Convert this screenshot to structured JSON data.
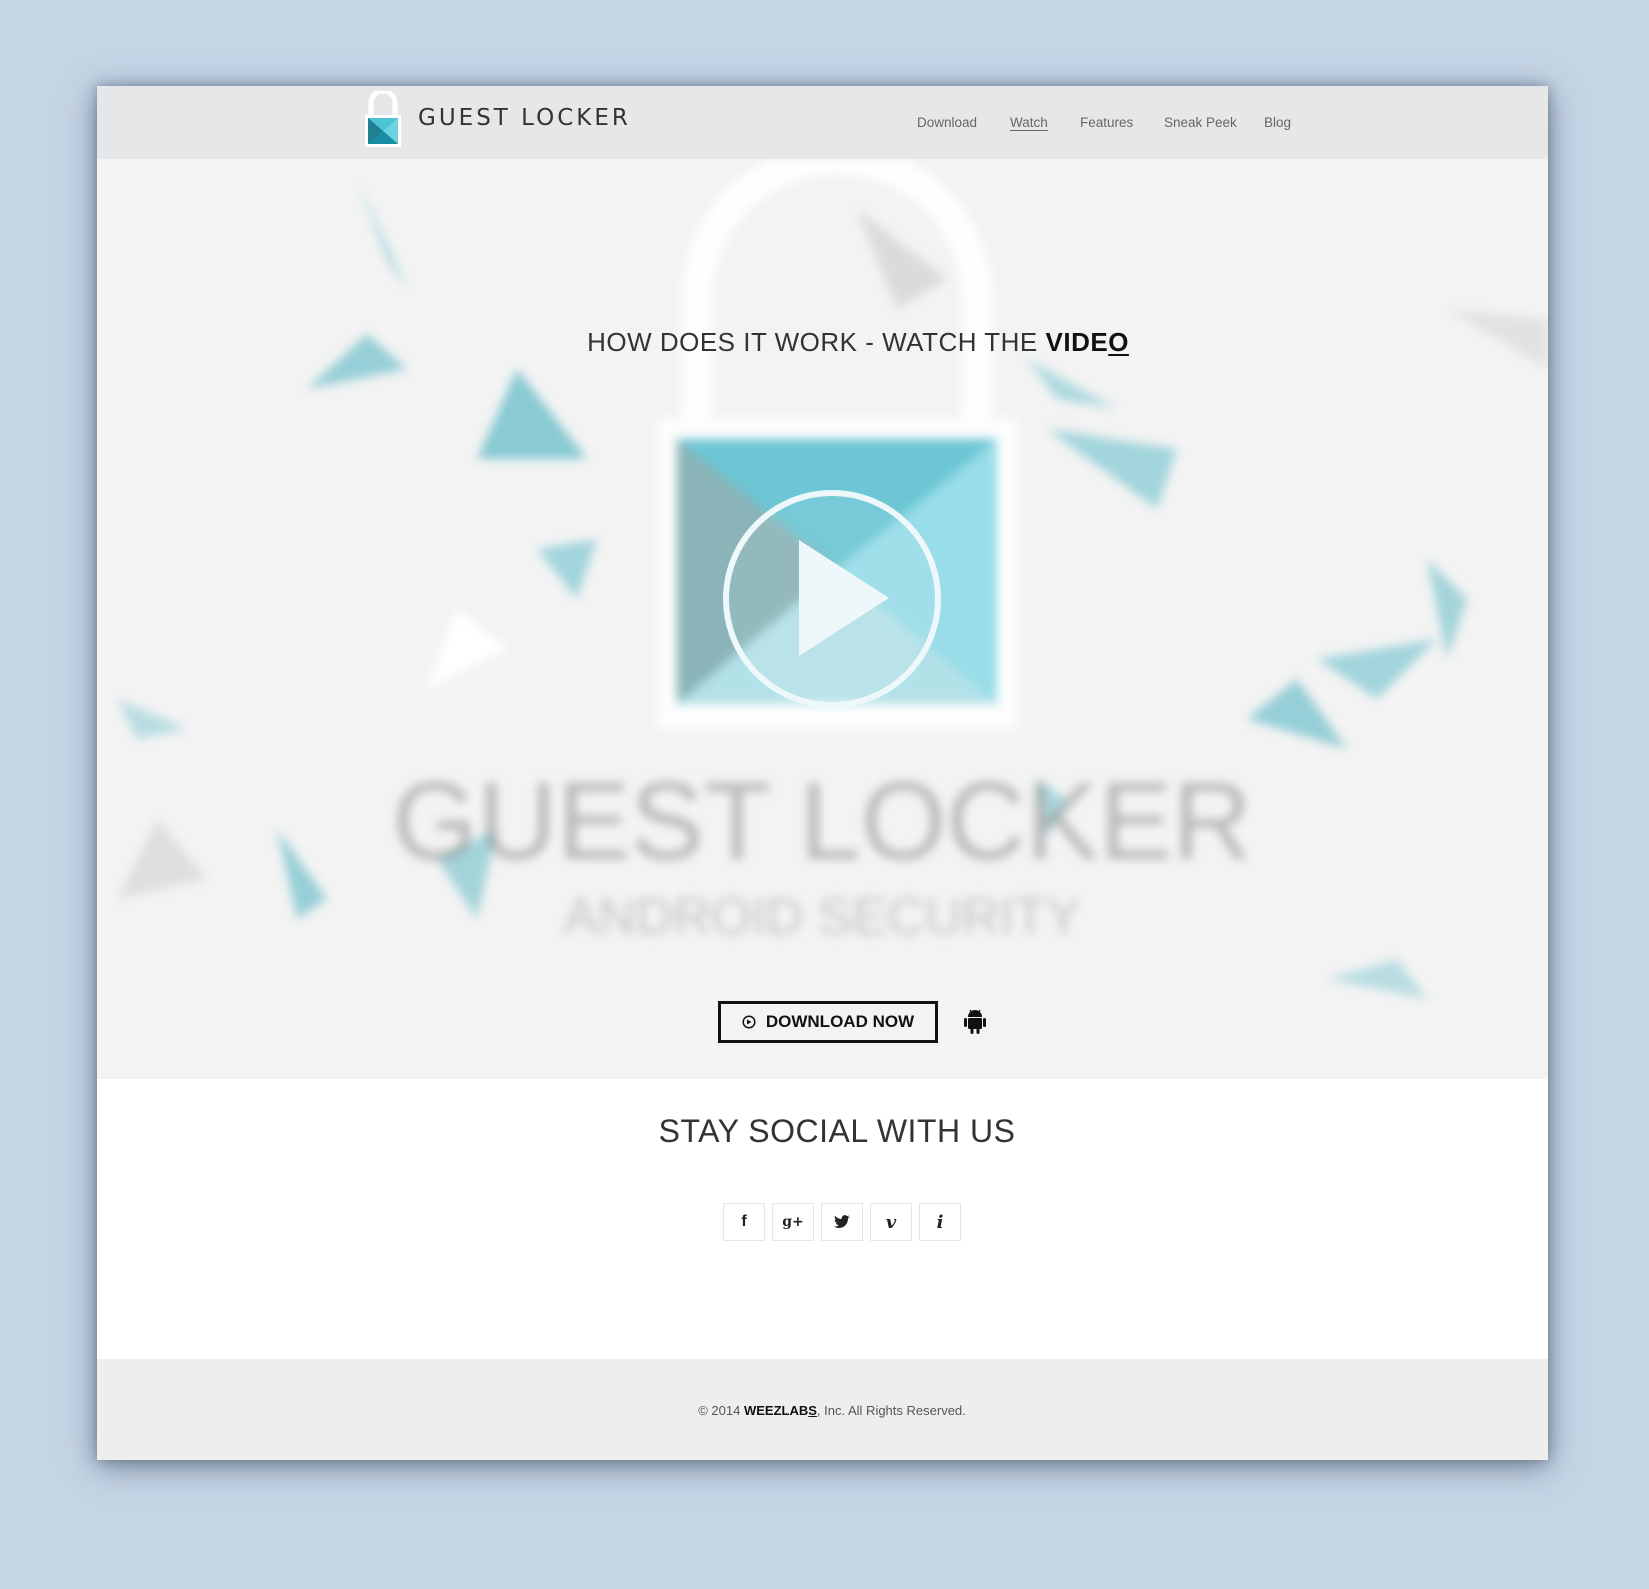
{
  "header": {
    "brand": "GUEST LOCKER",
    "nav": [
      {
        "label": "Download"
      },
      {
        "label": "Watch"
      },
      {
        "label": "Features"
      },
      {
        "label": "Sneak Peek"
      },
      {
        "label": "Blog"
      }
    ]
  },
  "hero": {
    "title_prefix": "HOW DOES IT WORK - WATCH THE ",
    "title_emphasis_start": "VIDE",
    "title_emphasis_end": "O",
    "background_text_line1": "GUEST LOCKER",
    "background_text_line2": "ANDROID SECURITY",
    "download_label": "DOWNLOAD NOW"
  },
  "social": {
    "heading": "STAY SOCIAL WITH US",
    "buttons": [
      {
        "icon": "facebook-icon",
        "glyph": "f"
      },
      {
        "icon": "google-plus-icon",
        "glyph": "g+"
      },
      {
        "icon": "twitter-icon",
        "glyph": "t"
      },
      {
        "icon": "vimeo-icon",
        "glyph": "v"
      },
      {
        "icon": "info-icon",
        "glyph": "i"
      }
    ]
  },
  "footer": {
    "copy_prefix": "© 2014 ",
    "company_start": "WEEZLAB",
    "company_end": "S",
    "copy_suffix": ", Inc. All Rights Reserved."
  },
  "colors": {
    "accent": "#4fb8c9",
    "page_bg": "#c6d5e6",
    "header_bg": "#e5e7e8",
    "hero_bg": "#f3f3f3"
  }
}
